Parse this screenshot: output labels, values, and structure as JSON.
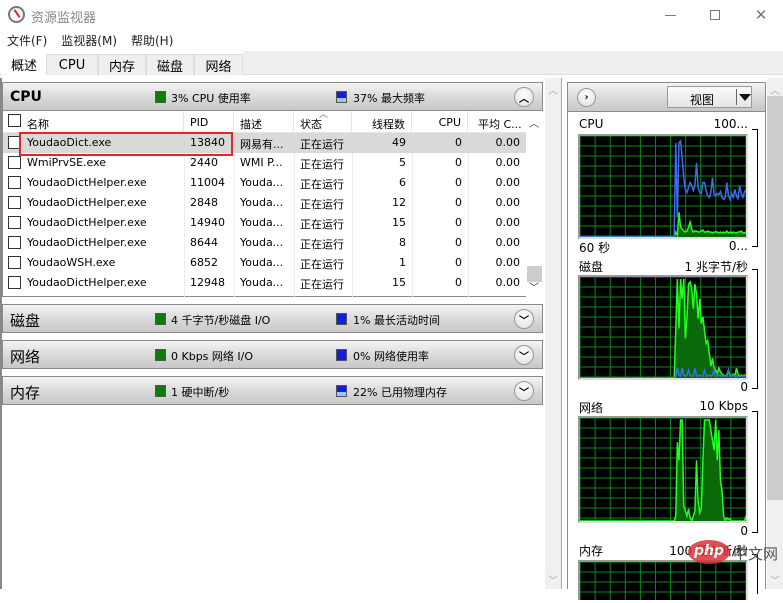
{
  "window": {
    "title": "资源监视器",
    "controls": {
      "minimize": "minimize",
      "maximize": "maximize",
      "close": "close"
    }
  },
  "menu": [
    "文件(F)",
    "监视器(M)",
    "帮助(H)"
  ],
  "tabs": [
    {
      "label": "概述",
      "active": true
    },
    {
      "label": "CPU",
      "active": false
    },
    {
      "label": "内存",
      "active": false
    },
    {
      "label": "磁盘",
      "active": false
    },
    {
      "label": "网络",
      "active": false
    }
  ],
  "cpu_section": {
    "title": "CPU",
    "stat1": "3% CPU 使用率",
    "stat2": "37% 最大频率",
    "stat2_fill_percent": 37,
    "expanded": true,
    "columns": [
      "名称",
      "PID",
      "描述",
      "状态",
      "线程数",
      "CPU",
      "平均 C..."
    ],
    "sorted_column": "状态",
    "rows": [
      {
        "name": "YoudaoDict.exe",
        "pid": "13840",
        "desc": "网易有...",
        "status": "正在运行",
        "threads": "49",
        "cpu": "0",
        "avg": "0.00",
        "selected": true,
        "highlighted": true
      },
      {
        "name": "WmiPrvSE.exe",
        "pid": "2440",
        "desc": "WMI P...",
        "status": "正在运行",
        "threads": "5",
        "cpu": "0",
        "avg": "0.00"
      },
      {
        "name": "YoudaoDictHelper.exe",
        "pid": "11004",
        "desc": "Youda...",
        "status": "正在运行",
        "threads": "6",
        "cpu": "0",
        "avg": "0.00"
      },
      {
        "name": "YoudaoDictHelper.exe",
        "pid": "2848",
        "desc": "Youda...",
        "status": "正在运行",
        "threads": "12",
        "cpu": "0",
        "avg": "0.00"
      },
      {
        "name": "YoudaoDictHelper.exe",
        "pid": "14940",
        "desc": "Youda...",
        "status": "正在运行",
        "threads": "15",
        "cpu": "0",
        "avg": "0.00"
      },
      {
        "name": "YoudaoDictHelper.exe",
        "pid": "8644",
        "desc": "Youda...",
        "status": "正在运行",
        "threads": "8",
        "cpu": "0",
        "avg": "0.00"
      },
      {
        "name": "YoudaoWSH.exe",
        "pid": "6852",
        "desc": "Youda...",
        "status": "正在运行",
        "threads": "1",
        "cpu": "0",
        "avg": "0.00"
      },
      {
        "name": "YoudaoDictHelper.exe",
        "pid": "12948",
        "desc": "Youda...",
        "status": "正在运行",
        "threads": "15",
        "cpu": "0",
        "avg": "0.00"
      }
    ]
  },
  "disk_section": {
    "title": "磁盘",
    "stat1": "4 千字节/秒磁盘 I/O",
    "stat2": "1% 最长活动时间"
  },
  "network_section": {
    "title": "网络",
    "stat1": "0 Kbps 网络 I/O",
    "stat2": "0% 网络使用率"
  },
  "memory_section": {
    "title": "内存",
    "stat1": "1 硬中断/秒",
    "stat2": "22% 已用物理内存",
    "stat2_fill_percent": 22
  },
  "right_panel": {
    "view_button": "视图",
    "graphs": [
      {
        "name": "CPU",
        "top_label": "100...",
        "bottom_left": "60 秒",
        "bottom_right": "0..."
      },
      {
        "name": "磁盘",
        "top_label": "1 兆字节/秒",
        "bottom_right": "0"
      },
      {
        "name": "网络",
        "top_label": "10 Kbps",
        "bottom_right": "0"
      },
      {
        "name": "内存",
        "top_label": "100 硬中断/秒"
      }
    ],
    "series": {
      "cpu_blue": [
        0,
        0,
        0,
        0,
        0,
        0,
        0,
        0,
        0,
        0,
        0,
        0,
        0,
        0,
        0,
        0,
        0,
        0,
        0,
        0,
        0,
        0,
        0,
        0,
        0,
        0,
        0,
        0,
        0,
        0,
        0,
        0,
        0,
        0,
        0,
        0,
        0,
        0,
        0,
        0,
        0,
        0,
        0,
        0,
        0,
        0,
        0,
        0,
        0,
        0,
        0,
        0,
        0,
        0,
        0,
        0,
        0,
        0,
        0,
        0,
        95,
        20,
        95,
        97,
        80,
        60,
        48,
        45,
        50,
        55,
        52,
        47,
        52,
        75,
        50,
        45,
        44,
        55,
        55,
        47,
        42,
        40,
        45,
        60,
        43,
        42,
        44,
        43,
        46,
        40,
        38,
        40,
        55,
        42,
        38,
        44,
        40,
        48,
        42,
        38,
        52,
        44,
        40,
        45,
        48
      ],
      "cpu_green": [
        0,
        0,
        0,
        0,
        0,
        0,
        0,
        0,
        0,
        0,
        0,
        0,
        0,
        0,
        0,
        0,
        0,
        0,
        0,
        0,
        0,
        0,
        0,
        0,
        0,
        0,
        0,
        0,
        0,
        0,
        0,
        0,
        0,
        0,
        0,
        0,
        0,
        0,
        0,
        0,
        0,
        0,
        0,
        0,
        0,
        0,
        0,
        0,
        0,
        0,
        0,
        0,
        0,
        0,
        0,
        0,
        0,
        0,
        0,
        0,
        5,
        2,
        25,
        10,
        8,
        6,
        5,
        6,
        10,
        15,
        8,
        5,
        6,
        6,
        5,
        5,
        6,
        7,
        5,
        5,
        6,
        5,
        5,
        4,
        5,
        5,
        5,
        4,
        5,
        4,
        5,
        4,
        6,
        4,
        5,
        4,
        5,
        4,
        4,
        5,
        5,
        6,
        4,
        4,
        5
      ],
      "disk_green": [
        0,
        0,
        0,
        0,
        0,
        0,
        0,
        0,
        0,
        0,
        0,
        0,
        0,
        0,
        0,
        0,
        0,
        0,
        0,
        0,
        0,
        0,
        0,
        0,
        0,
        0,
        0,
        0,
        0,
        0,
        0,
        0,
        0,
        0,
        0,
        0,
        0,
        0,
        0,
        0,
        0,
        0,
        0,
        0,
        0,
        0,
        0,
        0,
        0,
        0,
        0,
        0,
        0,
        0,
        0,
        0,
        0,
        0,
        0,
        0,
        50,
        100,
        50,
        100,
        80,
        100,
        40,
        60,
        95,
        97,
        90,
        70,
        95,
        85,
        60,
        80,
        55,
        62,
        48,
        35,
        38,
        25,
        12,
        20,
        10,
        8,
        5,
        10,
        6,
        4,
        3,
        2,
        3,
        8,
        3,
        2,
        4,
        2,
        10,
        4,
        2,
        3,
        2,
        3,
        2
      ],
      "disk_blue": [
        0,
        0,
        0,
        0,
        0,
        0,
        0,
        0,
        0,
        0,
        0,
        0,
        0,
        0,
        0,
        0,
        0,
        0,
        0,
        0,
        0,
        0,
        0,
        0,
        0,
        0,
        0,
        0,
        0,
        0,
        0,
        0,
        0,
        0,
        0,
        0,
        0,
        0,
        0,
        0,
        0,
        0,
        0,
        0,
        0,
        0,
        0,
        0,
        0,
        0,
        0,
        0,
        0,
        0,
        0,
        0,
        0,
        0,
        0,
        0,
        2,
        10,
        3,
        2,
        10,
        3,
        2,
        3,
        8,
        3,
        2,
        2,
        10,
        2,
        2,
        3,
        2,
        2,
        8,
        2,
        2,
        3,
        2,
        3,
        8,
        2,
        2,
        3,
        2,
        2,
        3,
        2,
        2,
        8,
        2,
        2,
        3,
        2,
        2,
        2,
        2,
        2,
        2,
        2,
        2
      ],
      "network_green": [
        0,
        0,
        0,
        0,
        0,
        0,
        0,
        0,
        0,
        0,
        0,
        0,
        0,
        0,
        0,
        0,
        0,
        0,
        0,
        0,
        0,
        0,
        0,
        0,
        0,
        0,
        0,
        0,
        0,
        0,
        0,
        0,
        0,
        0,
        0,
        0,
        0,
        0,
        0,
        0,
        0,
        0,
        0,
        0,
        0,
        0,
        0,
        0,
        0,
        0,
        0,
        0,
        0,
        0,
        0,
        0,
        0,
        0,
        0,
        0,
        5,
        78,
        60,
        100,
        100,
        15,
        10,
        5,
        12,
        3,
        0,
        5,
        10,
        60,
        20,
        8,
        12,
        60,
        100,
        100,
        100,
        100,
        90,
        80,
        70,
        100,
        60,
        90,
        40,
        30,
        5,
        0,
        3,
        2,
        2,
        0,
        0,
        0,
        0,
        0,
        0,
        0,
        0,
        0,
        5
      ]
    }
  },
  "watermark": {
    "pill": "php",
    "text": "中文网"
  }
}
